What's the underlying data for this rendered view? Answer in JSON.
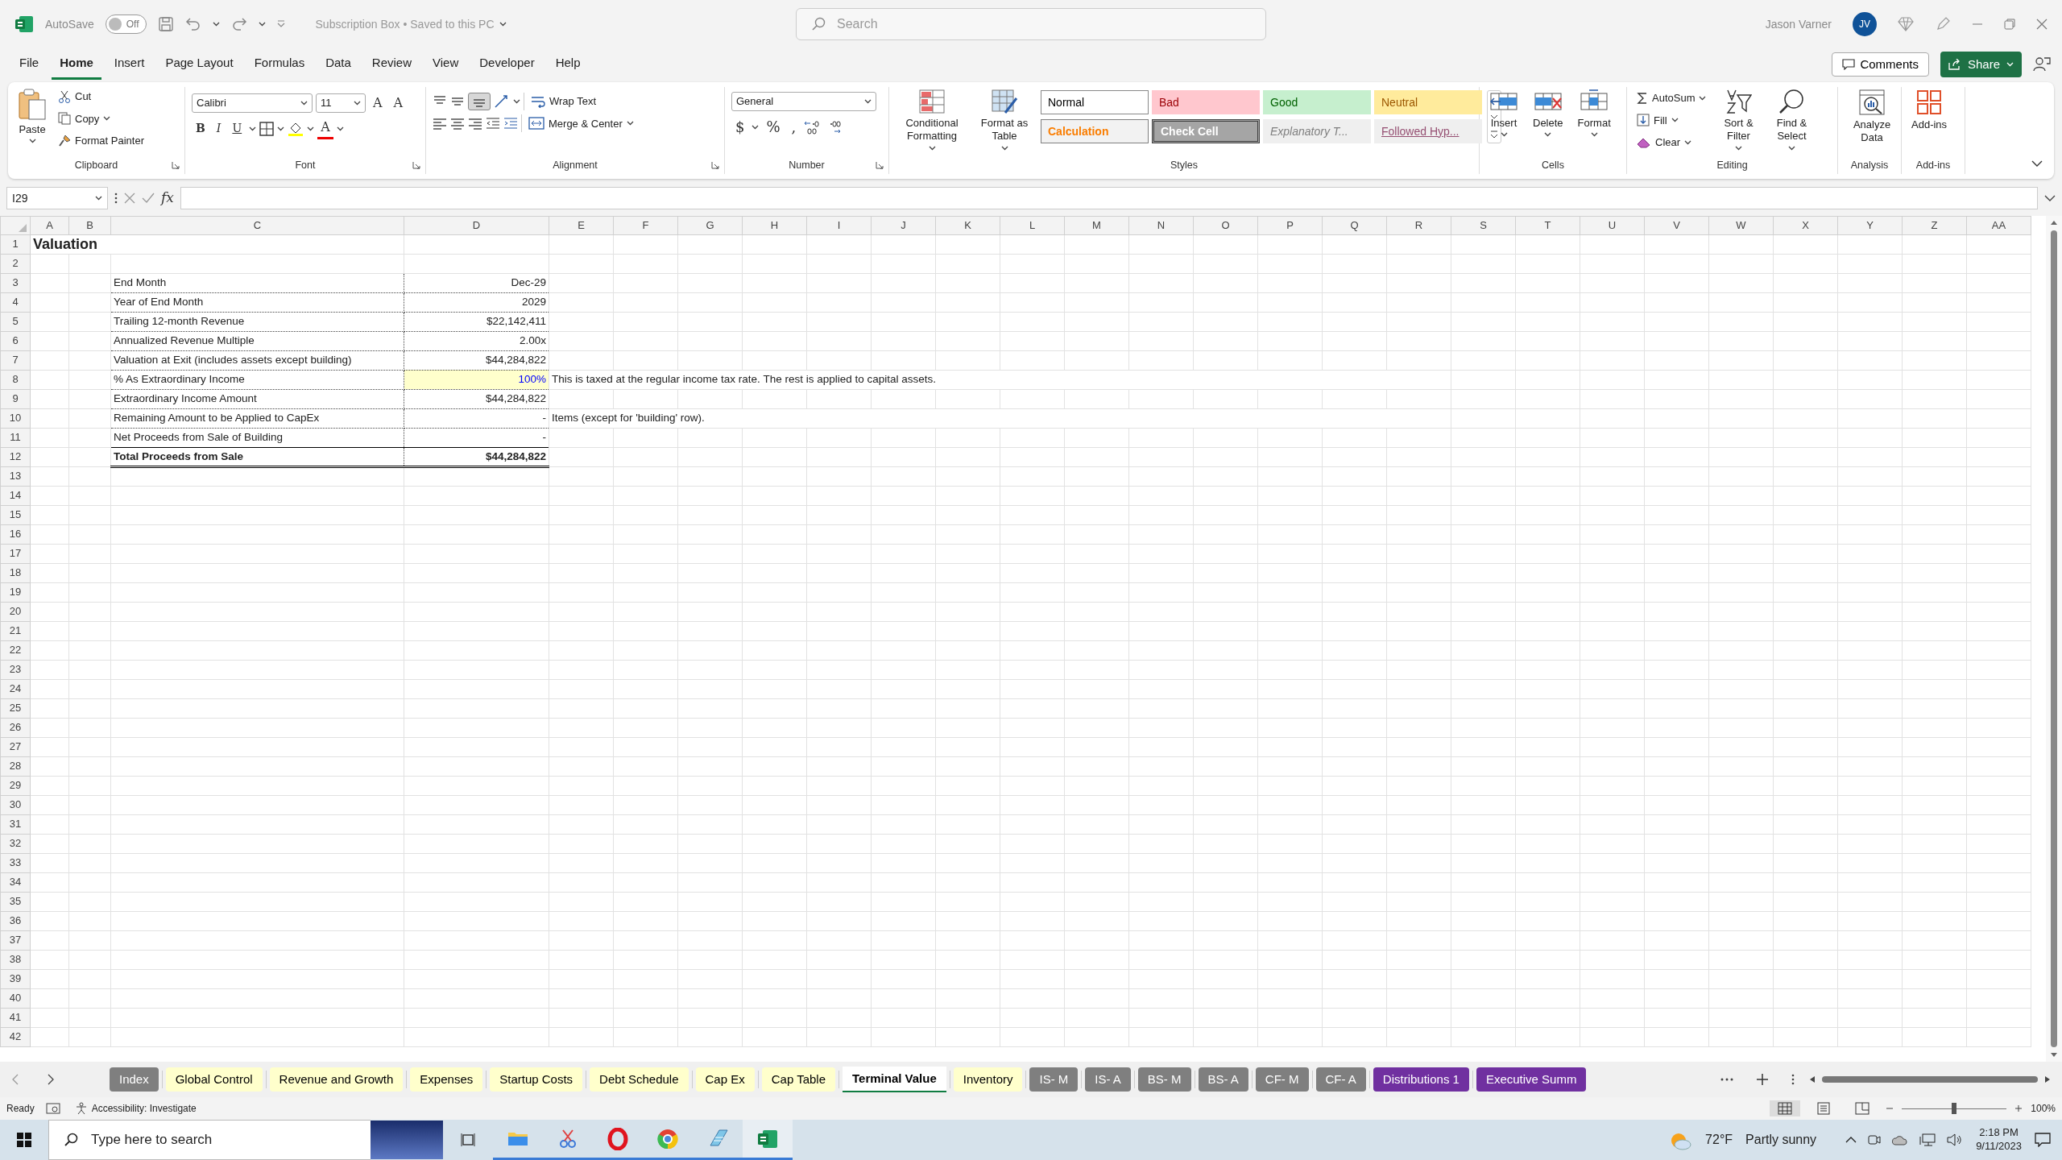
{
  "title_bar": {
    "autosave_label": "AutoSave",
    "autosave_on": false,
    "autosave_state": "Off",
    "document_title": "Subscription Box • Saved to this PC",
    "search_placeholder": "Search",
    "user_name": "Jason Varner",
    "avatar_initials": "JV"
  },
  "menu_tabs": [
    {
      "label": "File",
      "selected": false
    },
    {
      "label": "Home",
      "selected": true
    },
    {
      "label": "Insert",
      "selected": false
    },
    {
      "label": "Page Layout",
      "selected": false
    },
    {
      "label": "Formulas",
      "selected": false
    },
    {
      "label": "Data",
      "selected": false
    },
    {
      "label": "Review",
      "selected": false
    },
    {
      "label": "View",
      "selected": false
    },
    {
      "label": "Developer",
      "selected": false
    },
    {
      "label": "Help",
      "selected": false
    }
  ],
  "comments_button": "Comments",
  "share_button": "Share",
  "ribbon": {
    "clipboard": {
      "label": "Clipboard",
      "paste": "Paste",
      "cut": "Cut",
      "copy": "Copy",
      "format_painter": "Format Painter"
    },
    "font": {
      "label": "Font",
      "font_name": "Calibri",
      "font_size": "11",
      "grow_font": "A",
      "shrink_font": "A",
      "bold": "B",
      "italic": "I",
      "underline": "U",
      "font_color": "A"
    },
    "alignment": {
      "label": "Alignment",
      "wrap_text": "Wrap Text",
      "merge_center": "Merge & Center"
    },
    "number": {
      "label": "Number",
      "format": "General",
      "currency": "$",
      "percent": "%",
      "comma": ","
    },
    "styles": {
      "label": "Styles",
      "conditional_formatting": "Conditional Formatting",
      "format_as_table": "Format as Table",
      "items": [
        {
          "label": "Normal",
          "kind": "normal"
        },
        {
          "label": "Bad",
          "kind": "bad"
        },
        {
          "label": "Good",
          "kind": "good"
        },
        {
          "label": "Neutral",
          "kind": "neutral"
        },
        {
          "label": "Calculation",
          "kind": "calculation"
        },
        {
          "label": "Check Cell",
          "kind": "check"
        },
        {
          "label": "Explanatory T...",
          "kind": "explanatory"
        },
        {
          "label": "Followed Hyp...",
          "kind": "followed"
        }
      ]
    },
    "cells": {
      "label": "Cells",
      "insert": "Insert",
      "delete": "Delete",
      "format": "Format"
    },
    "editing": {
      "label": "Editing",
      "autosum": "AutoSum",
      "fill": "Fill",
      "clear": "Clear",
      "sort_filter": "Sort & Filter",
      "find_select": "Find & Select"
    },
    "analysis": {
      "label": "Analysis",
      "analyze_data": "Analyze Data"
    },
    "addins": {
      "label": "Add-ins",
      "addins": "Add-ins"
    }
  },
  "formula_bar": {
    "name_box": "I29",
    "fx": "fx"
  },
  "sheet": {
    "columns": [
      "A",
      "B",
      "C",
      "D",
      "E",
      "F",
      "G",
      "H",
      "I",
      "J",
      "K",
      "L",
      "M",
      "N",
      "O",
      "P",
      "Q",
      "R",
      "S",
      "T",
      "U",
      "V",
      "W",
      "X",
      "Y",
      "Z",
      "AA"
    ],
    "rows": [
      "1",
      "2",
      "3",
      "4",
      "5",
      "6",
      "7",
      "8",
      "9",
      "10",
      "11",
      "12",
      "13",
      "14",
      "15",
      "16",
      "17",
      "18",
      "19",
      "20",
      "21",
      "22",
      "23",
      "24",
      "25",
      "26",
      "27",
      "28",
      "29",
      "30",
      "31",
      "32",
      "33",
      "34",
      "35",
      "36",
      "37",
      "38",
      "39",
      "40",
      "41",
      "42"
    ],
    "title": "Valuation",
    "table": [
      {
        "label": "End Month",
        "value": "Dec-29",
        "kind": "normal"
      },
      {
        "label": "Year of End Month",
        "value": "2029",
        "kind": "normal"
      },
      {
        "label": "Trailing 12-month Revenue",
        "value": "$22,142,411",
        "kind": "normal"
      },
      {
        "label": "Annualized Revenue Multiple",
        "value": "2.00x",
        "kind": "normal"
      },
      {
        "label": "Valuation at Exit (includes assets except building)",
        "value": "$44,284,822",
        "kind": "normal"
      },
      {
        "label": "% As Extraordinary Income",
        "value": "100%",
        "kind": "input",
        "note": "This is taxed at the regular income tax rate. The rest is applied to capital assets."
      },
      {
        "label": "Extraordinary Income Amount",
        "value": "$44,284,822",
        "kind": "normal"
      },
      {
        "label": "Remaining Amount to be Applied to CapEx",
        "value": "-",
        "kind": "normal",
        "note": "Items (except for 'building' row)."
      },
      {
        "label": "Net Proceeds from Sale of Building",
        "value": "-",
        "kind": "normal"
      },
      {
        "label": "Total Proceeds from Sale",
        "value": "$44,284,822",
        "kind": "total"
      }
    ]
  },
  "sheet_tabs": [
    {
      "label": "Index",
      "selected": false,
      "color": "#7f7f7f"
    },
    {
      "label": "Global Control",
      "selected": false,
      "color": "#ffffcc"
    },
    {
      "label": "Revenue and Growth",
      "selected": false,
      "color": "#ffffcc"
    },
    {
      "label": "Expenses",
      "selected": false,
      "color": "#ffffcc"
    },
    {
      "label": "Startup Costs",
      "selected": false,
      "color": "#ffffcc"
    },
    {
      "label": "Debt Schedule",
      "selected": false,
      "color": "#ffffcc"
    },
    {
      "label": "Cap Ex",
      "selected": false,
      "color": "#ffffcc"
    },
    {
      "label": "Cap Table",
      "selected": false,
      "color": "#ffffcc"
    },
    {
      "label": "Terminal Value",
      "selected": true
    },
    {
      "label": "Inventory",
      "selected": false,
      "color": "#ffffcc"
    },
    {
      "label": "IS- M",
      "selected": false,
      "color": "#7f7f7f"
    },
    {
      "label": "IS- A",
      "selected": false,
      "color": "#7f7f7f"
    },
    {
      "label": "BS- M",
      "selected": false,
      "color": "#7f7f7f"
    },
    {
      "label": "BS- A",
      "selected": false,
      "color": "#7f7f7f"
    },
    {
      "label": "CF- M",
      "selected": false,
      "color": "#7f7f7f"
    },
    {
      "label": "CF- A",
      "selected": false,
      "color": "#7f7f7f"
    },
    {
      "label": "Distributions 1",
      "selected": false,
      "color": "#7030a0"
    },
    {
      "label": "Executive Summ",
      "selected": false,
      "color": "#7030a0"
    }
  ],
  "status_bar": {
    "ready": "Ready",
    "accessibility": "Accessibility: Investigate",
    "views": [
      {
        "kind": "normal",
        "selected": true
      },
      {
        "kind": "page_layout",
        "selected": false
      },
      {
        "kind": "page_break",
        "selected": false
      }
    ],
    "zoom_slider": {
      "level": 0.5
    },
    "zoom": "100%"
  },
  "taskbar": {
    "search_placeholder": "Type here to search",
    "apps": [
      {
        "kind": "folder",
        "running": true,
        "selected": false
      },
      {
        "kind": "scissors",
        "running": true,
        "selected": false
      },
      {
        "kind": "opera",
        "running": true,
        "selected": false
      },
      {
        "kind": "chrome",
        "running": true,
        "selected": false
      },
      {
        "kind": "notepad",
        "running": true,
        "selected": false
      },
      {
        "kind": "excel",
        "running": true,
        "selected": true
      }
    ],
    "temperature": "72°F",
    "weather": "Partly sunny",
    "time": "2:18 PM",
    "date": "9/11/2023"
  }
}
